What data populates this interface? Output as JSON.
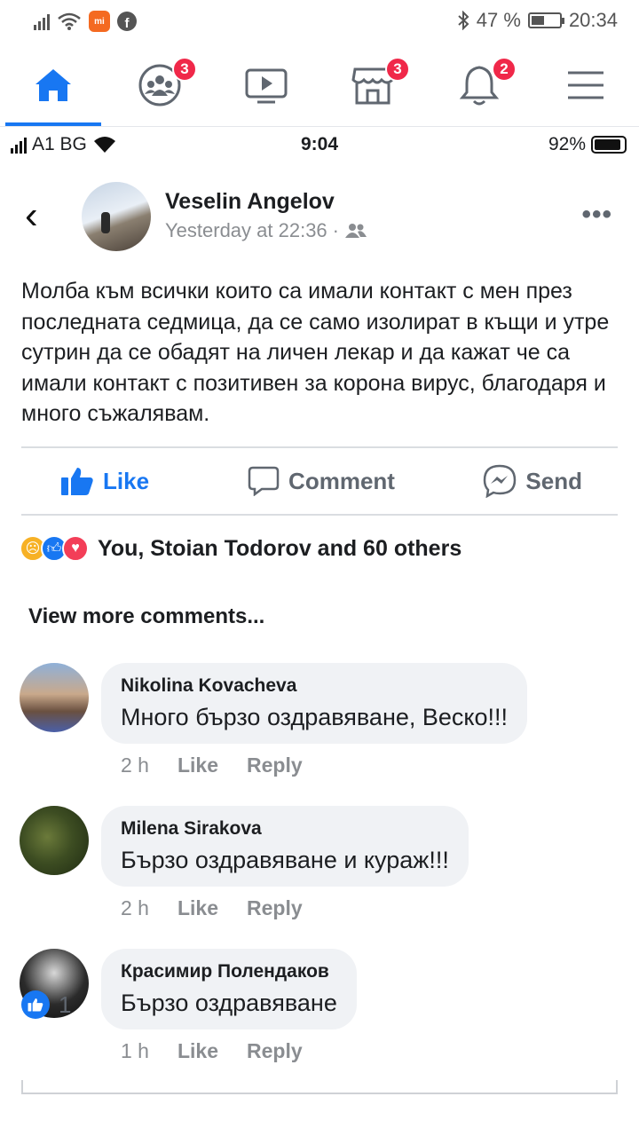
{
  "os_status": {
    "battery": "47 %",
    "time": "20:34"
  },
  "nav": {
    "groups_badge": "3",
    "marketplace_badge": "3",
    "notifications_badge": "2"
  },
  "inner_status": {
    "carrier": "A1 BG",
    "time": "9:04",
    "battery": "92%"
  },
  "post": {
    "author": "Veselin Angelov",
    "time": "Yesterday at 22:36",
    "separator": "·",
    "text": "Молба към всички които са имали контакт с мен през последната седмица, да се само изолират в къщи и утре сутрин да се обадят на личен лекар и да кажат че са имали контакт с позитивен за корона вирус, благодаря и много съжалявам.",
    "like_label": "Like",
    "comment_label": "Comment",
    "send_label": "Send",
    "reactions_text": "You, Stoian Todorov and 60 others",
    "view_more": "View more comments..."
  },
  "comments": [
    {
      "name": "Nikolina Kovacheva",
      "text": "Много бързо оздравяване, Веско!!!",
      "time": "2 h",
      "like": "Like",
      "reply": "Reply"
    },
    {
      "name": "Milena Sirakova",
      "text": "Бързо оздравяване и кураж!!!",
      "time": "2 h",
      "like": "Like",
      "reply": "Reply"
    },
    {
      "name": "Красимир Полендаков",
      "text": "Бързо оздравяване",
      "time": "1 h",
      "like": "Like",
      "reply": "Reply"
    }
  ],
  "bottom": {
    "like_count": "1"
  },
  "colors": {
    "fb_blue": "#1877f2",
    "badge_red": "#f02849",
    "bubble": "#f0f2f5",
    "muted": "#8a8d91"
  }
}
